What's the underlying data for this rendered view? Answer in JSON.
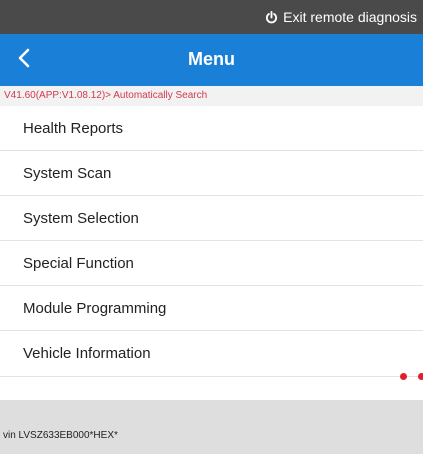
{
  "topbar": {
    "exit_label": "Exit remote diagnosis",
    "exit_icon": "power-icon"
  },
  "header": {
    "title": "Menu",
    "back_icon": "chevron-left-icon",
    "background": "#1a7fd7"
  },
  "version_text": "V41.60(APP:V1.08.12)> Automatically Search",
  "menu": {
    "items": [
      {
        "label": "Health Reports"
      },
      {
        "label": "System Scan"
      },
      {
        "label": "System Selection"
      },
      {
        "label": "Special Function"
      },
      {
        "label": "Module Programming"
      },
      {
        "label": "Vehicle Information"
      }
    ]
  },
  "footer": {
    "vin": "vin LVSZ633EB000*HEX*"
  },
  "colors": {
    "accent": "#1a7fd7",
    "version_text": "#d23a4e",
    "topbar": "#4a4a4a",
    "dots": "#e0202c"
  }
}
